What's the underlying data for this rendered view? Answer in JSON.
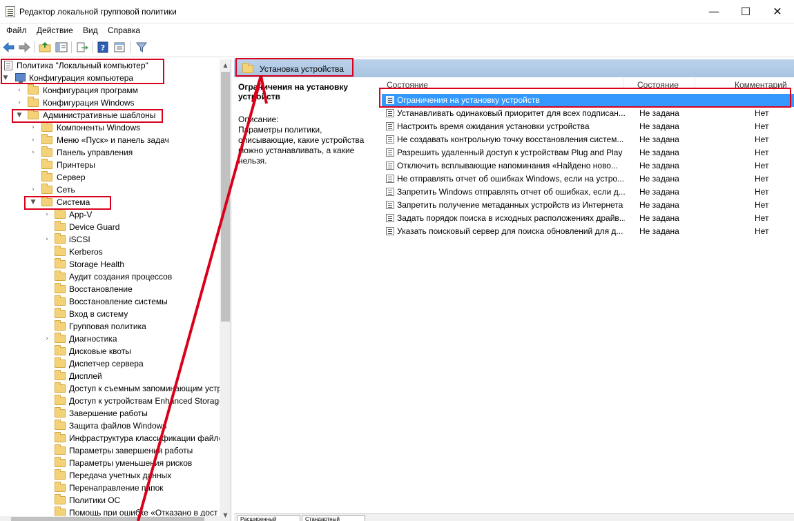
{
  "window": {
    "title": "Редактор локальной групповой политики",
    "minimize_glyph": "—",
    "maximize_glyph": "☐",
    "close_glyph": "✕"
  },
  "menu": [
    "Файл",
    "Действие",
    "Вид",
    "Справка"
  ],
  "toolbar": {
    "icons": [
      "back-arrow-icon",
      "forward-arrow-icon",
      "up-folder-icon",
      "show-hide-tree-icon",
      "export-list-icon",
      "help-icon",
      "properties-icon",
      "filter-icon"
    ]
  },
  "tree": {
    "root": "Политика \"Локальный компьютер\"",
    "computer_config": "Конфигурация компьютера",
    "program_config": "Конфигурация программ",
    "windows_config": "Конфигурация Windows",
    "admin_templates": "Административные шаблоны",
    "admin_children": [
      "Компоненты Windows",
      "Меню «Пуск» и панель задач",
      "Панель управления",
      "Принтеры",
      "Сервер",
      "Сеть"
    ],
    "system": "Система",
    "system_children": [
      "App-V",
      "Device Guard",
      "iSCSI",
      "Kerberos",
      "Storage Health",
      "Аудит создания процессов",
      "Восстановление",
      "Восстановление системы",
      "Вход в систему",
      "Групповая политика",
      "Диагностика",
      "Дисковые квоты",
      "Диспетчер сервера",
      "Дисплей",
      "Доступ к съемным запоминающим устр",
      "Доступ к устройствам Enhanced Storage",
      "Завершение работы",
      "Защита файлов Windows",
      "Инфраструктура классификации файлов",
      "Параметры завершения работы",
      "Параметры уменьшения рисков",
      "Передача учетных данных",
      "Перенаправление папок",
      "Политики ОС",
      "Помощь при ошибке «Отказано в дост"
    ]
  },
  "right": {
    "folder_title": "Установка устройства",
    "desc_title": "Ограничения на установку устройств",
    "desc_label": "Описание:",
    "desc_text": "Параметры политики, описывающие, какие устройства можно устанавливать, а какие нельзя.",
    "columns": {
      "name": "Состояние",
      "state": "Состояние",
      "comment": "Комментарий"
    },
    "rows": [
      {
        "name": "Ограничения на установку устройств",
        "state": "",
        "comment": ""
      },
      {
        "name": "Устанавливать одинаковый приоритет для всех подписан...",
        "state": "Не задана",
        "comment": "Нет"
      },
      {
        "name": "Настроить время ожидания установки устройства",
        "state": "Не задана",
        "comment": "Нет"
      },
      {
        "name": "Не создавать контрольную точку восстановления систем...",
        "state": "Не задана",
        "comment": "Нет"
      },
      {
        "name": "Разрешить удаленный доступ к устройствам Plug and Play",
        "state": "Не задана",
        "comment": "Нет"
      },
      {
        "name": "Отключить всплывающие напоминания «Найдено ново...",
        "state": "Не задана",
        "comment": "Нет"
      },
      {
        "name": "Не отправлять отчет об ошибках Windows, если на устро...",
        "state": "Не задана",
        "comment": "Нет"
      },
      {
        "name": "Запретить Windows отправлять отчет об ошибках, если д...",
        "state": "Не задана",
        "comment": "Нет"
      },
      {
        "name": "Запретить получение метаданных устройств из Интернета",
        "state": "Не задана",
        "comment": "Нет"
      },
      {
        "name": "Задать порядок поиска в исходных расположениях драйв...",
        "state": "Не задана",
        "comment": "Нет"
      },
      {
        "name": "Указать поисковый сервер для поиска обновлений для д...",
        "state": "Не задана",
        "comment": "Нет"
      }
    ],
    "tabs": [
      "Расширенный",
      "Стандартный"
    ]
  },
  "colors": {
    "selection": "#3399ff",
    "annotation": "#d9001b",
    "header_band": "#b4cce8"
  }
}
